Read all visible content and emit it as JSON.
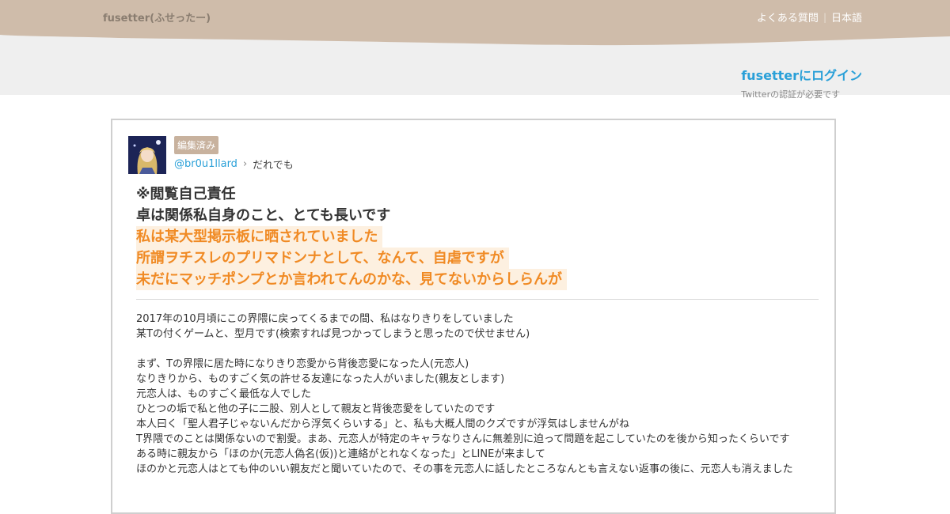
{
  "header": {
    "logo": "fusetter(ふせったー)",
    "nav": {
      "faq": "よくある質問",
      "separator": "|",
      "language": "日本語"
    },
    "login": {
      "link": "fusetterにログイン",
      "note": "Twitterの認証が必要です"
    }
  },
  "post": {
    "badge": "編集済み",
    "username": "@br0u1llard",
    "audience": "だれでも",
    "headline": {
      "lines": [
        "※閲覧自己責任",
        "卓は関係私自身のこと、とても長いです"
      ],
      "highlight_lines": [
        "私は某大型掲示板に晒されていました",
        "所謂ヲチスレのプリマドンナとして、なんて、自虐ですが",
        "未だにマッチポンプとか言われてんのかな、見てないからしらんが"
      ]
    },
    "body": [
      "2017年の10月頃にこの界隈に戻ってくるまでの間、私はなりきりをしていました",
      "某Tの付くゲームと、型月です(検索すれば見つかってしまうと思ったので伏せません)",
      "",
      "まず、Tの界隈に居た時になりきり恋愛から背後恋愛になった人(元恋人)",
      "なりきりから、ものすごく気の許せる友達になった人がいました(親友とします)",
      "元恋人は、ものすごく最低な人でした",
      "ひとつの垢で私と他の子に二股、別人として親友と背後恋愛をしていたのです",
      "本人曰く「聖人君子じゃないんだから浮気くらいする」と、私も大概人間のクズですが浮気はしませんがね",
      "T界隈でのことは関係ないので割愛。まあ、元恋人が特定のキャラなりさんに無差別に迫って問題を起こしていたのを後から知ったくらいです",
      "ある時に親友から「ほのか(元恋人偽名(仮))と連絡がとれなくなった」とLINEが来まして",
      "ほのかと元恋人はとても仲のいい親友だと聞いていたので、その事を元恋人に話したところなんとも言えない返事の後に、元恋人も消えました"
    ]
  },
  "colors": {
    "header_band": "#cfbcaa",
    "accent_link": "#2aa0d8",
    "highlight_text": "#f08a24",
    "highlight_bg": "#fdf0e0",
    "badge_bg": "#c8b29e"
  }
}
